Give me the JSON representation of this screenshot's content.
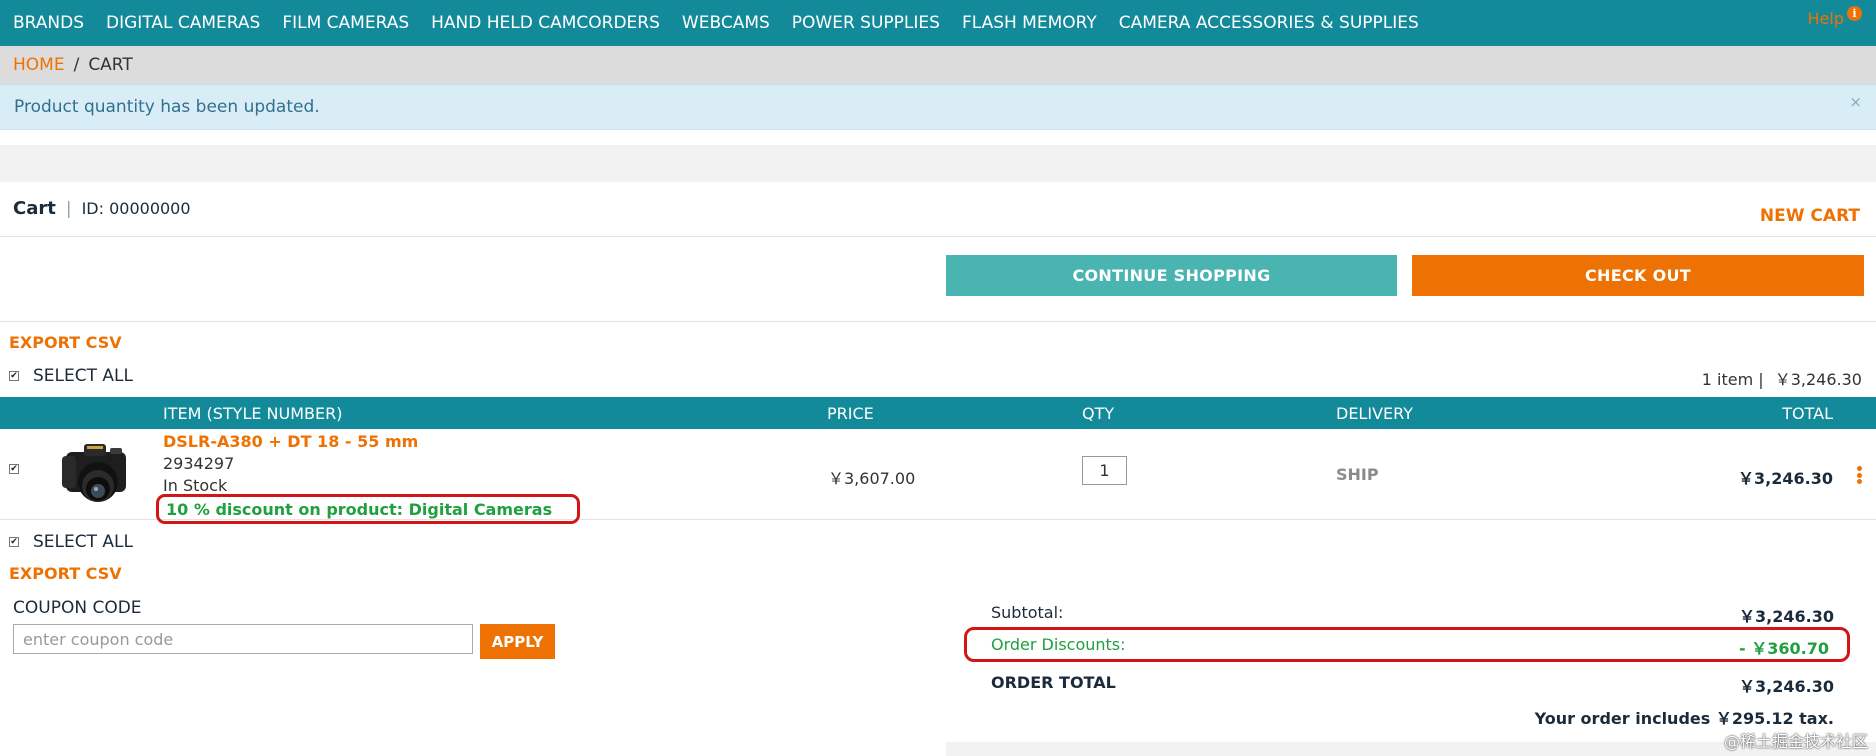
{
  "nav": {
    "items": [
      "BRANDS",
      "DIGITAL CAMERAS",
      "FILM CAMERAS",
      "HAND HELD CAMCORDERS",
      "WEBCAMS",
      "POWER SUPPLIES",
      "FLASH MEMORY",
      "CAMERA ACCESSORIES & SUPPLIES"
    ]
  },
  "breadcrumb": {
    "home": "HOME",
    "separator": "/",
    "current": "CART"
  },
  "alert": {
    "message": "Product quantity has been updated.",
    "close": "×"
  },
  "help": {
    "label": "Help",
    "icon": "info-icon"
  },
  "cart": {
    "title": "Cart",
    "separator": "|",
    "id_label": "ID: 00000000",
    "new_cart": "NEW CART"
  },
  "actions": {
    "continue": "CONTINUE SHOPPING",
    "checkout": "CHECK OUT"
  },
  "list": {
    "export": "EXPORT CSV",
    "select_all": "SELECT ALL",
    "summary_count": "1 item |",
    "summary_total": "￥3,246.30"
  },
  "table": {
    "columns": {
      "item": "ITEM (STYLE NUMBER)",
      "price": "PRICE",
      "qty": "QTY",
      "delivery": "DELIVERY",
      "total": "TOTAL"
    },
    "rows": [
      {
        "name": "DSLR-A380 + DT 18 - 55 mm",
        "sku": "2934297",
        "stock": "In Stock",
        "discount": "10 % discount on product: Digital Cameras",
        "price": "￥3,607.00",
        "qty": "1",
        "delivery": "SHIP",
        "total": "￥3,246.30",
        "thumbnail": "camera-icon"
      }
    ]
  },
  "coupon": {
    "label": "COUPON CODE",
    "placeholder": "enter coupon code",
    "apply": "APPLY"
  },
  "totals": {
    "subtotal_label": "Subtotal:",
    "subtotal_value": "￥3,246.30",
    "discount_label": "Order Discounts:",
    "discount_value": "- ￥360.70",
    "order_total_label": "ORDER TOTAL",
    "order_total_value": "￥3,246.30",
    "tax_note": "Your order includes ￥295.12 tax."
  },
  "watermark": "@稀土掘金技术社区",
  "colors": {
    "teal": "#138a9a",
    "orange": "#ee7203",
    "green": "#20a040",
    "highlight": "#d51515",
    "button_teal": "#4ab5b0"
  }
}
